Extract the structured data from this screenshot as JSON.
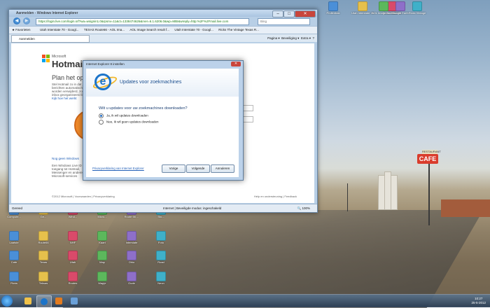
{
  "window": {
    "title": "Aanmelden - Windows Internet Explorer",
    "address": "https://login.live.com/login.srf?wa=wsignin1.0&rpsnv=11&ct=1338474626&rver=6.1.6206.0&wp=MBI&wreply=http:%2F%2Fmail.live.com",
    "search_placeholder": "Bing",
    "favorites_label": "Favorieten",
    "favorites": [
      "Utah Interstate 70 - Googl...",
      "TEXAS Route66 - AOL Ima...",
      "AOL Image Search result f...",
      "Utah Interstate 70 - Googl...",
      "Ricks The Vintage Texas R..."
    ],
    "tab_label": "Aanmelden",
    "tools": [
      "Pagina ▾",
      "Beveiliging ▾",
      "Extra ▾",
      "?"
    ],
    "status_left": "Gereed",
    "status_mid": "Internet | Beveiligde modus: ingeschakeld",
    "zoom": "100%"
  },
  "page": {
    "logo_small": "Microsoft",
    "logo_big": "Hotmail",
    "heading": "Plan het opn",
    "paragraph": "Stel Hotmail zo in dat je berichten automatisch worden verwijderd, zodat je inbox georganiseerd blijft.",
    "more_link": "Kijk hoe het werkt",
    "windows_link": "Nog geen Windows",
    "windows_text": "Een Windows Live ID geeft je toegang tot Hotmail, Messenger en andere Microsoft-services",
    "footer_left": "©2012 Microsoft  |  Voorwaarden  |  Privacyverklaring",
    "footer_right": "Help en ondersteuning  |  Feedback"
  },
  "dialog": {
    "title": "Internet Explorer 8 instellen",
    "close": "✕",
    "heading": "Updates voor zoekmachines",
    "question": "Wilt u updates voor uw zoekmachines downloaden?",
    "option_yes": "Ja, ik wil updates downloaden",
    "option_no": "Nee, ik wil geen updates downloaden",
    "privacy_link": "Privacyverklaring van Internet Explorer",
    "btn_prev": "Vorige",
    "btn_next": "Volgende",
    "btn_cancel": "Annuleren"
  },
  "sign": {
    "top": "RESTAURANT",
    "main": "CAFE"
  },
  "desktop_icons": [
    "Prullenbak",
    "Utah Interstate 70",
    "Texas Route66",
    "AOL Image Search",
    "Google Earth",
    "Ricks Vintage",
    "Compute...",
    "Ge...",
    "Wind...",
    "Micro...",
    "Route 66 ...",
    "Sto...",
    "Laatste",
    "Route66",
    "NHF",
    "Kaart",
    "Interstate",
    "Foto",
    "Cafe",
    "Texas",
    "Utah",
    "Map",
    "Ohio",
    "Road",
    "Ricks",
    "Teksas",
    "Routes",
    "Mapje",
    "Oude",
    "Neon"
  ],
  "taskbar": {
    "time": "10:27",
    "date": "25-5-2012"
  },
  "colors": {
    "ie_blue": "#1c74c9",
    "link": "#2461b8",
    "cafe_red": "#d93c2c"
  }
}
